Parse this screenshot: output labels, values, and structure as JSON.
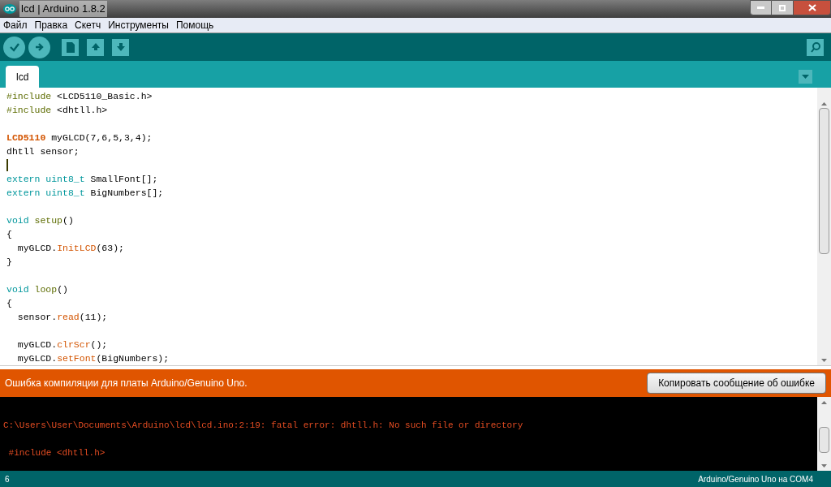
{
  "window": {
    "title": "lcd | Arduino 1.8.2"
  },
  "menu": [
    "Файл",
    "Правка",
    "Скетч",
    "Инструменты",
    "Помощь"
  ],
  "tabs": [
    {
      "label": "lcd",
      "selected": true
    }
  ],
  "code_lines": [
    {
      "tokens": [
        {
          "text": "#include",
          "kind": "preproc"
        },
        {
          "text": " <LCD5110_Basic.h>",
          "kind": "plain"
        }
      ]
    },
    {
      "tokens": [
        {
          "text": "#include",
          "kind": "preproc"
        },
        {
          "text": " <dhtll.h>",
          "kind": "plain"
        }
      ]
    },
    {
      "kind": "blank"
    },
    {
      "tokens": [
        {
          "text": "LCD5110",
          "kind": "class"
        },
        {
          "text": " myGLCD(7,6,5,3,4);",
          "kind": "plain"
        }
      ]
    },
    {
      "tokens": [
        {
          "text": "dhtll sensor;",
          "kind": "plain"
        }
      ]
    },
    {
      "kind": "cursor"
    },
    {
      "tokens": [
        {
          "text": "extern uint8_t",
          "kind": "type"
        },
        {
          "text": " SmallFont[];",
          "kind": "plain"
        }
      ]
    },
    {
      "tokens": [
        {
          "text": "extern uint8_t",
          "kind": "type"
        },
        {
          "text": " BigNumbers[];",
          "kind": "plain"
        }
      ]
    },
    {
      "kind": "blank"
    },
    {
      "tokens": [
        {
          "text": "void",
          "kind": "type"
        },
        {
          "text": " setup",
          "kind": "preproc"
        },
        {
          "text": "()",
          "kind": "plain"
        }
      ]
    },
    {
      "tokens": [
        {
          "text": "{",
          "kind": "plain"
        }
      ]
    },
    {
      "tokens": [
        {
          "text": "  myGLCD.",
          "kind": "plain"
        },
        {
          "text": "InitLCD",
          "kind": "func"
        },
        {
          "text": "(63);",
          "kind": "plain"
        }
      ]
    },
    {
      "tokens": [
        {
          "text": "}",
          "kind": "plain"
        }
      ]
    },
    {
      "kind": "blank"
    },
    {
      "tokens": [
        {
          "text": "void",
          "kind": "type"
        },
        {
          "text": " loop",
          "kind": "preproc"
        },
        {
          "text": "()",
          "kind": "plain"
        }
      ]
    },
    {
      "tokens": [
        {
          "text": "{",
          "kind": "plain"
        }
      ]
    },
    {
      "tokens": [
        {
          "text": "  sensor.",
          "kind": "plain"
        },
        {
          "text": "read",
          "kind": "func"
        },
        {
          "text": "(11);",
          "kind": "plain"
        }
      ]
    },
    {
      "kind": "blank"
    },
    {
      "tokens": [
        {
          "text": "  myGLCD.",
          "kind": "plain"
        },
        {
          "text": "clrScr",
          "kind": "func"
        },
        {
          "text": "();",
          "kind": "plain"
        }
      ]
    },
    {
      "tokens": [
        {
          "text": "  myGLCD.",
          "kind": "plain"
        },
        {
          "text": "setFont",
          "kind": "func"
        },
        {
          "text": "(BigNumbers);",
          "kind": "plain"
        }
      ]
    }
  ],
  "error_bar": {
    "message": "Ошибка компиляции для платы Arduino/Genuino Uno.",
    "button": "Копировать сообщение об ошибке"
  },
  "console_lines": [
    "C:\\Users\\User\\Documents\\Arduino\\lcd\\lcd.ino:2:19: fatal error: dhtll.h: No such file or directory",
    " #include <dhtll.h>"
  ],
  "status_bar": {
    "line": "6",
    "board": "Arduino/Genuino Uno на COM4"
  }
}
